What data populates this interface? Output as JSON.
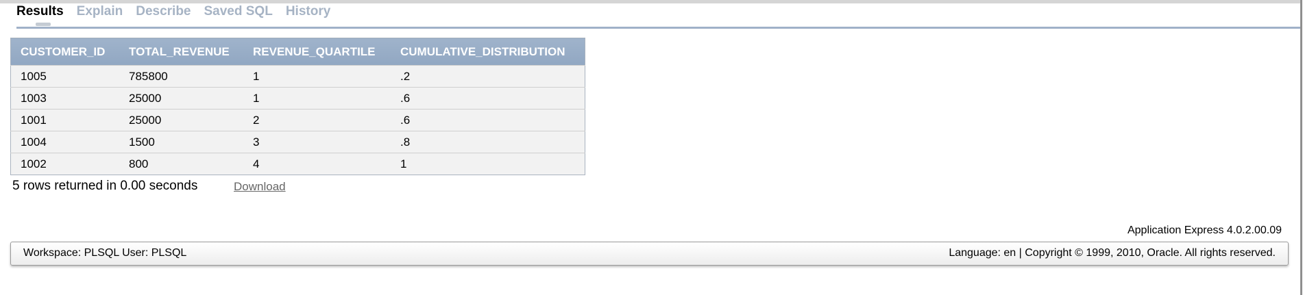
{
  "tabs": [
    {
      "label": "Results",
      "active": true
    },
    {
      "label": "Explain",
      "active": false
    },
    {
      "label": "Describe",
      "active": false
    },
    {
      "label": "Saved SQL",
      "active": false
    },
    {
      "label": "History",
      "active": false
    }
  ],
  "table": {
    "columns": [
      "CUSTOMER_ID",
      "TOTAL_REVENUE",
      "REVENUE_QUARTILE",
      "CUMULATIVE_DISTRIBUTION"
    ],
    "rows": [
      [
        "1005",
        "785800",
        "1",
        ".2"
      ],
      [
        "1003",
        "25000",
        "1",
        ".6"
      ],
      [
        "1001",
        "25000",
        "2",
        ".6"
      ],
      [
        "1004",
        "1500",
        "3",
        ".8"
      ],
      [
        "1002",
        "800",
        "4",
        "1"
      ]
    ]
  },
  "results_footer": {
    "status": "5 rows returned in 0.00 seconds",
    "download_label": "Download"
  },
  "app_version": "Application Express 4.0.2.00.09",
  "bottom_bar": {
    "workspace_text": "Workspace: PLSQL User: PLSQL",
    "language_copyright": "Language: en | Copyright © 1999, 2010, Oracle. All rights reserved."
  },
  "colors": {
    "tab_inactive": "#a6b3c4",
    "header_bg": "#9fb3cb",
    "row_bg": "#f2f2f2"
  }
}
